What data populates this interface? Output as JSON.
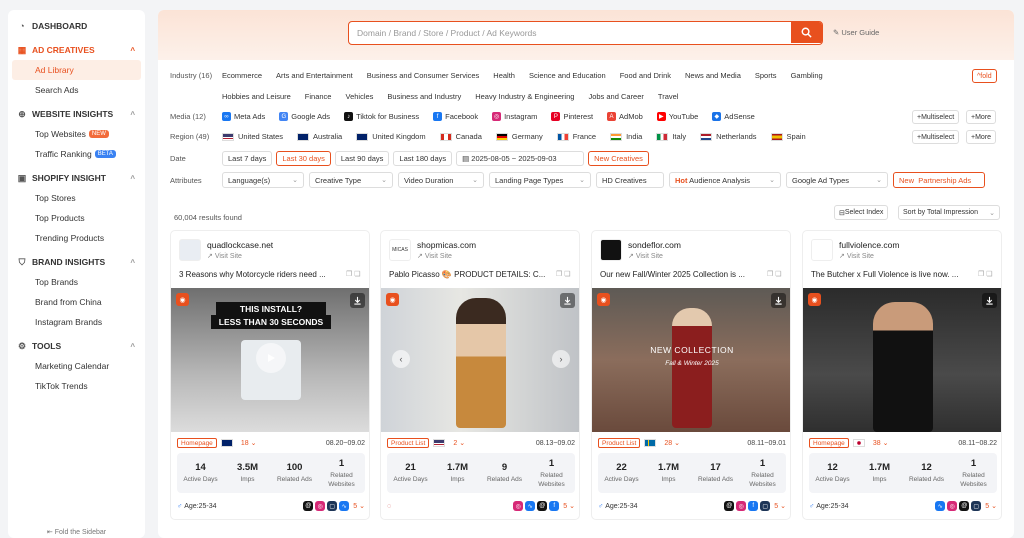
{
  "sidebar": {
    "dashboard": "DASHBOARD",
    "ad_creatives": "AD CREATIVES",
    "ad_library": "Ad Library",
    "search_ads": "Search Ads",
    "website_insights": "WEBSITE INSIGHTS",
    "top_websites": "Top Websites",
    "new_badge": "NEW",
    "traffic_ranking": "Traffic Ranking",
    "beta_badge": "BETA",
    "shopify_insight": "SHOPIFY INSIGHT",
    "top_stores": "Top Stores",
    "top_products": "Top Products",
    "trending_products": "Trending Products",
    "brand_insights": "BRAND INSIGHTS",
    "top_brands": "Top Brands",
    "brand_from_china": "Brand from China",
    "instagram_brands": "Instagram Brands",
    "tools": "TOOLS",
    "marketing_calendar": "Marketing Calendar",
    "tiktok_trends": "TikTok Trends",
    "fold": "Fold the Sidebar"
  },
  "search": {
    "placeholder": "Domain / Brand / Store / Product / Ad Keywords",
    "user_guide": "User Guide"
  },
  "filters": {
    "industry_label": "Industry (16)",
    "industries": [
      "Ecommerce",
      "Arts and Entertainment",
      "Business and Consumer Services",
      "Health",
      "Science and Education",
      "Food and Drink",
      "News and Media",
      "Sports",
      "Gambling"
    ],
    "industries2": [
      "Hobbies and Leisure",
      "Finance",
      "Vehicles",
      "Business and Industry",
      "Heavy Industry & Engineering",
      "Jobs and Career",
      "Travel"
    ],
    "fold_label": "fold",
    "media_label": "Media (12)",
    "media": [
      {
        "name": "Meta Ads",
        "color": "#1877f2",
        "icon": "∞"
      },
      {
        "name": "Google Ads",
        "color": "#4285f4",
        "icon": "G"
      },
      {
        "name": "Tiktok for Business",
        "color": "#111111",
        "icon": "♪"
      },
      {
        "name": "Facebook",
        "color": "#1877f2",
        "icon": "f"
      },
      {
        "name": "Instagram",
        "color": "#d62976",
        "icon": "◎"
      },
      {
        "name": "Pinterest",
        "color": "#e60023",
        "icon": "P"
      },
      {
        "name": "AdMob",
        "color": "#ea4335",
        "icon": "A"
      },
      {
        "name": "YouTube",
        "color": "#ff0000",
        "icon": "▶"
      },
      {
        "name": "AdSense",
        "color": "#1a73e8",
        "icon": "◆"
      }
    ],
    "multiselect": "Multiselect",
    "more": "More",
    "region_label": "Region (49)",
    "regions": [
      "United States",
      "Australia",
      "United Kingdom",
      "Canada",
      "Germany",
      "France",
      "India",
      "Italy",
      "Netherlands",
      "Spain"
    ],
    "date_label": "Date",
    "dates": [
      "Last 7 days",
      "Last 30 days",
      "Last 90 days",
      "Last 180 days"
    ],
    "date_range": "2025-08-05 ~ 2025-09-03",
    "new_creatives": "New Creatives",
    "attr_label": "Attributes",
    "attrs": [
      "Language(s)",
      "Creative Type",
      "Video Duration",
      "Landing Page Types"
    ],
    "hd": "HD Creatives",
    "hot": "Hot",
    "audience": "Audience Analysis",
    "google_ad_types": "Google Ad Types",
    "new_tag": "New",
    "partnership": "Partnership Ads"
  },
  "results": {
    "count": "60,004 results found",
    "select_index": "Select Index",
    "sort": "Sort by Total Impression"
  },
  "cards": [
    {
      "domain": "quadlockcase.net",
      "visit": "Visit Site",
      "title": "3 Reasons why Motorcycle riders need ...",
      "tag": "Homepage",
      "count": "18",
      "date": "08.20~09.02",
      "stats": [
        {
          "v": "14",
          "l": "Active Days"
        },
        {
          "v": "3.5M",
          "l": "Imps"
        },
        {
          "v": "100",
          "l": "Related Ads"
        },
        {
          "v": "1",
          "l": "Related Websites"
        }
      ],
      "age": "Age:25-34",
      "more": "5",
      "overlay1": "THIS INSTALL?",
      "overlay2": "LESS THAN 30 SECONDS"
    },
    {
      "domain": "shopmicas.com",
      "visit": "Visit Site",
      "title": "Pablo Picasso 🎨 PRODUCT DETAILS: C...",
      "tag": "Product List",
      "count": "2",
      "date": "08.13~09.02",
      "stats": [
        {
          "v": "21",
          "l": "Active Days"
        },
        {
          "v": "1.7M",
          "l": "Imps"
        },
        {
          "v": "9",
          "l": "Related Ads"
        },
        {
          "v": "1",
          "l": "Related Websites"
        }
      ],
      "age": "",
      "more": "5",
      "logo": "MICAS"
    },
    {
      "domain": "sondeflor.com",
      "visit": "Visit Site",
      "title": "Our new Fall/Winter 2025 Collection is ...",
      "tag": "Product List",
      "count": "28",
      "date": "08.11~09.01",
      "stats": [
        {
          "v": "22",
          "l": "Active Days"
        },
        {
          "v": "1.7M",
          "l": "Imps"
        },
        {
          "v": "17",
          "l": "Related Ads"
        },
        {
          "v": "1",
          "l": "Related Websites"
        }
      ],
      "age": "Age:25-34",
      "more": "5",
      "overlay1": "NEW COLLECTION",
      "overlay2": "Fall & Winter 2025"
    },
    {
      "domain": "fullviolence.com",
      "visit": "Visit Site",
      "title": "The Butcher x Full Violence is live now. ...",
      "tag": "Homepage",
      "count": "38",
      "date": "08.11~08.22",
      "stats": [
        {
          "v": "12",
          "l": "Active Days"
        },
        {
          "v": "1.7M",
          "l": "Imps"
        },
        {
          "v": "12",
          "l": "Related Ads"
        },
        {
          "v": "1",
          "l": "Related Websites"
        }
      ],
      "age": "Age:25-34",
      "more": "5"
    }
  ]
}
